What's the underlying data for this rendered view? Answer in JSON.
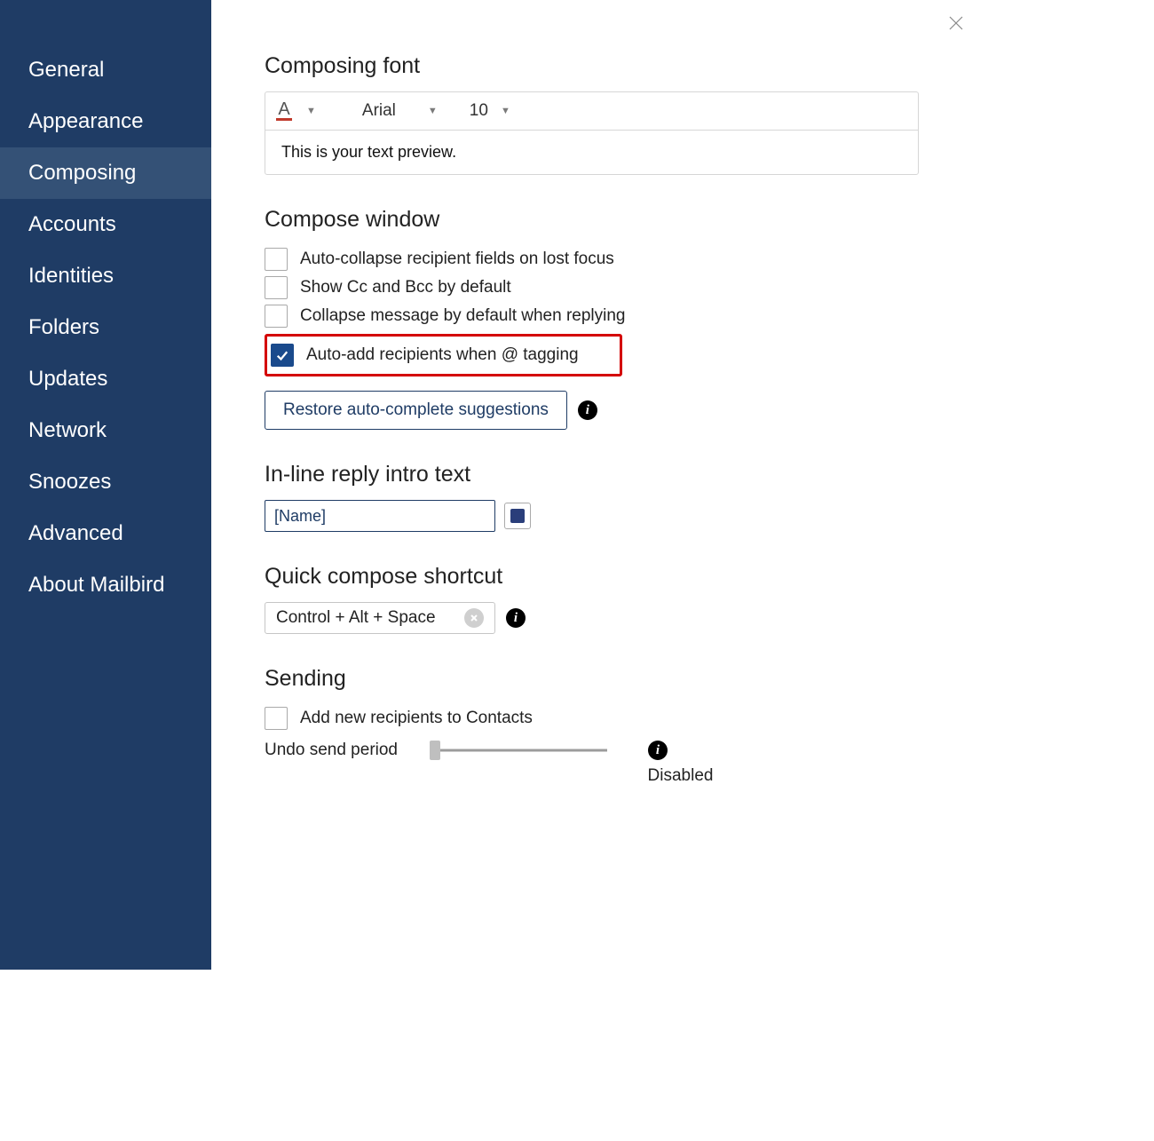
{
  "sidebar": {
    "items": [
      {
        "label": "General"
      },
      {
        "label": "Appearance"
      },
      {
        "label": "Composing"
      },
      {
        "label": "Accounts"
      },
      {
        "label": "Identities"
      },
      {
        "label": "Folders"
      },
      {
        "label": "Updates"
      },
      {
        "label": "Network"
      },
      {
        "label": "Snoozes"
      },
      {
        "label": "Advanced"
      },
      {
        "label": "About Mailbird"
      }
    ],
    "selected_index": 2
  },
  "composing_font": {
    "heading": "Composing font",
    "font_family": "Arial",
    "font_size": "10",
    "preview_text": "This is your text preview."
  },
  "compose_window": {
    "heading": "Compose window",
    "options": [
      {
        "label": "Auto-collapse recipient fields on lost focus",
        "checked": false
      },
      {
        "label": "Show Cc and Bcc by default",
        "checked": false
      },
      {
        "label": "Collapse message by default when replying",
        "checked": false
      },
      {
        "label": "Auto-add recipients when @ tagging",
        "checked": true
      }
    ],
    "restore_button": "Restore auto-complete suggestions"
  },
  "inline_reply": {
    "heading": "In-line reply intro text",
    "value": "[Name]",
    "swatch_color": "#2a3e7a"
  },
  "quick_compose": {
    "heading": "Quick compose shortcut",
    "value": "Control + Alt + Space"
  },
  "sending": {
    "heading": "Sending",
    "add_recipients_label": "Add new recipients to Contacts",
    "add_recipients_checked": false,
    "undo_label": "Undo send period",
    "undo_value": "Disabled"
  }
}
